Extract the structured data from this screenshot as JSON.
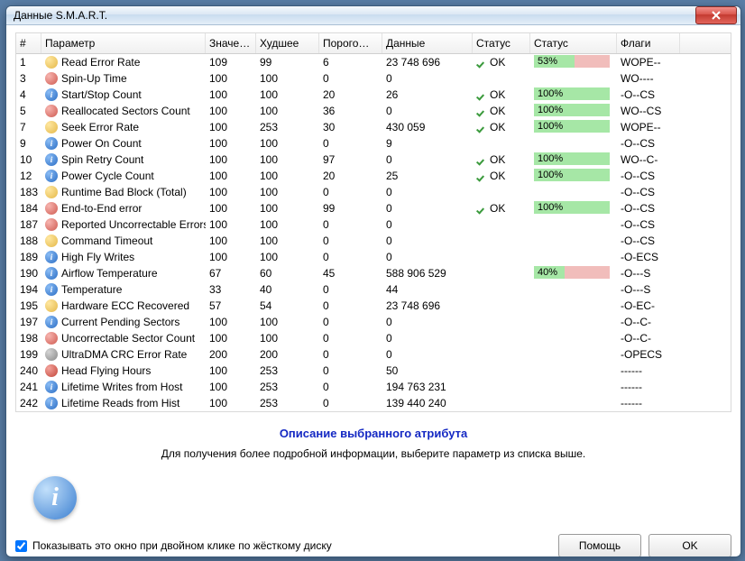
{
  "window": {
    "title": "Данные S.M.A.R.T."
  },
  "columns": [
    "#",
    "Параметр",
    "Значе…",
    "Худшее",
    "Порого…",
    "Данные",
    "Статус",
    "Статус",
    "Флаги"
  ],
  "rows": [
    {
      "id": "1",
      "icon": "warn",
      "param": "Read Error Rate",
      "val": "109",
      "worst": "99",
      "thr": "6",
      "data": "23 748 696",
      "ok": true,
      "pct": 53,
      "flags": "WOPE--"
    },
    {
      "id": "3",
      "icon": "err",
      "param": "Spin-Up Time",
      "val": "100",
      "worst": "100",
      "thr": "0",
      "data": "0",
      "ok": false,
      "pct": null,
      "flags": "WO----"
    },
    {
      "id": "4",
      "icon": "info",
      "param": "Start/Stop Count",
      "val": "100",
      "worst": "100",
      "thr": "20",
      "data": "26",
      "ok": true,
      "pct": 100,
      "flags": "-O--CS"
    },
    {
      "id": "5",
      "icon": "err",
      "param": "Reallocated Sectors Count",
      "val": "100",
      "worst": "100",
      "thr": "36",
      "data": "0",
      "ok": true,
      "pct": 100,
      "flags": "WO--CS"
    },
    {
      "id": "7",
      "icon": "warn",
      "param": "Seek Error Rate",
      "val": "100",
      "worst": "253",
      "thr": "30",
      "data": "430 059",
      "ok": true,
      "pct": 100,
      "flags": "WOPE--"
    },
    {
      "id": "9",
      "icon": "info",
      "param": "Power On Count",
      "val": "100",
      "worst": "100",
      "thr": "0",
      "data": "9",
      "ok": false,
      "pct": null,
      "flags": "-O--CS"
    },
    {
      "id": "10",
      "icon": "info",
      "param": "Spin Retry Count",
      "val": "100",
      "worst": "100",
      "thr": "97",
      "data": "0",
      "ok": true,
      "pct": 100,
      "flags": "WO--C-"
    },
    {
      "id": "12",
      "icon": "info",
      "param": "Power Cycle Count",
      "val": "100",
      "worst": "100",
      "thr": "20",
      "data": "25",
      "ok": true,
      "pct": 100,
      "flags": "-O--CS"
    },
    {
      "id": "183",
      "icon": "warn",
      "param": "Runtime Bad Block (Total)",
      "val": "100",
      "worst": "100",
      "thr": "0",
      "data": "0",
      "ok": false,
      "pct": null,
      "flags": "-O--CS"
    },
    {
      "id": "184",
      "icon": "err",
      "param": "End-to-End error",
      "val": "100",
      "worst": "100",
      "thr": "99",
      "data": "0",
      "ok": true,
      "pct": 100,
      "flags": "-O--CS"
    },
    {
      "id": "187",
      "icon": "err",
      "param": "Reported Uncorrectable Errors",
      "val": "100",
      "worst": "100",
      "thr": "0",
      "data": "0",
      "ok": false,
      "pct": null,
      "flags": "-O--CS"
    },
    {
      "id": "188",
      "icon": "warn",
      "param": "Command Timeout",
      "val": "100",
      "worst": "100",
      "thr": "0",
      "data": "0",
      "ok": false,
      "pct": null,
      "flags": "-O--CS"
    },
    {
      "id": "189",
      "icon": "info",
      "param": "High Fly Writes",
      "val": "100",
      "worst": "100",
      "thr": "0",
      "data": "0",
      "ok": false,
      "pct": null,
      "flags": "-O-ECS"
    },
    {
      "id": "190",
      "icon": "info",
      "param": "Airflow Temperature",
      "val": "67",
      "worst": "60",
      "thr": "45",
      "data": "588 906 529",
      "ok": false,
      "pct": 40,
      "flags": "-O---S"
    },
    {
      "id": "194",
      "icon": "info",
      "param": "Temperature",
      "val": "33",
      "worst": "40",
      "thr": "0",
      "data": "44",
      "ok": false,
      "pct": null,
      "flags": "-O---S"
    },
    {
      "id": "195",
      "icon": "warn",
      "param": "Hardware ECC Recovered",
      "val": "57",
      "worst": "54",
      "thr": "0",
      "data": "23 748 696",
      "ok": false,
      "pct": null,
      "flags": "-O-EC-"
    },
    {
      "id": "197",
      "icon": "info",
      "param": "Current Pending Sectors",
      "val": "100",
      "worst": "100",
      "thr": "0",
      "data": "0",
      "ok": false,
      "pct": null,
      "flags": "-O--C-"
    },
    {
      "id": "198",
      "icon": "err",
      "param": "Uncorrectable Sector Count",
      "val": "100",
      "worst": "100",
      "thr": "0",
      "data": "0",
      "ok": false,
      "pct": null,
      "flags": "-O--C-"
    },
    {
      "id": "199",
      "icon": "gray",
      "param": "UltraDMA CRC Error Rate",
      "val": "200",
      "worst": "200",
      "thr": "0",
      "data": "0",
      "ok": false,
      "pct": null,
      "flags": "-OPECS"
    },
    {
      "id": "240",
      "icon": "red",
      "param": "Head Flying Hours",
      "val": "100",
      "worst": "253",
      "thr": "0",
      "data": "50",
      "ok": false,
      "pct": null,
      "flags": "------"
    },
    {
      "id": "241",
      "icon": "info",
      "param": "Lifetime Writes from Host",
      "val": "100",
      "worst": "253",
      "thr": "0",
      "data": "194 763 231",
      "ok": false,
      "pct": null,
      "flags": "------"
    },
    {
      "id": "242",
      "icon": "info",
      "param": "Lifetime Reads from Hist",
      "val": "100",
      "worst": "253",
      "thr": "0",
      "data": "139 440 240",
      "ok": false,
      "pct": null,
      "flags": "------"
    }
  ],
  "desc": {
    "title": "Описание выбранного атрибута",
    "sub": "Для получения более подробной информации, выберите параметр из списка выше."
  },
  "footer": {
    "checkbox": "Показывать это окно при двойном клике по жёсткому диску",
    "help": "Помощь",
    "ok": "OK"
  },
  "status_ok_label": "OK"
}
